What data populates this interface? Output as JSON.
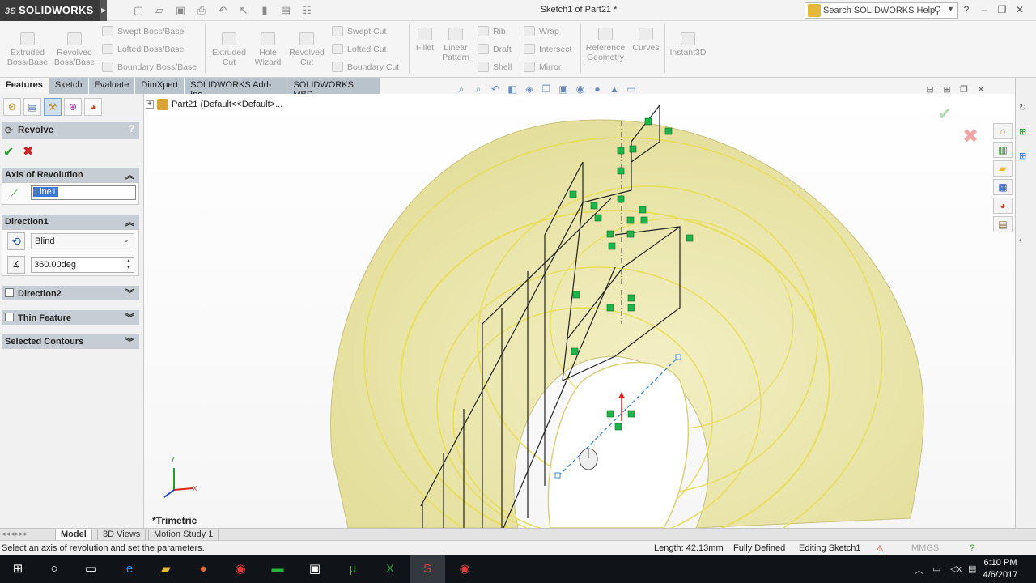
{
  "app": {
    "logo_text": "SOLIDWORKS",
    "logo_ds": "3S",
    "document_title": "Sketch1 of Part21 *",
    "search_placeholder": "Search SOLIDWORKS Help"
  },
  "commands": {
    "extruded_boss": "Extruded\nBoss/Base",
    "revolved_boss": "Revolved\nBoss/Base",
    "swept_boss": "Swept Boss/Base",
    "lofted_boss": "Lofted Boss/Base",
    "boundary_boss": "Boundary Boss/Base",
    "extruded_cut": "Extruded\nCut",
    "hole_wizard": "Hole\nWizard",
    "revolved_cut": "Revolved\nCut",
    "swept_cut": "Swept Cut",
    "lofted_cut": "Lofted Cut",
    "boundary_cut": "Boundary Cut",
    "fillet": "Fillet",
    "linear_pattern": "Linear\nPattern",
    "rib": "Rib",
    "draft": "Draft",
    "shell": "Shell",
    "wrap": "Wrap",
    "intersect": "Intersect",
    "mirror": "Mirror",
    "reference_geometry": "Reference\nGeometry",
    "curves": "Curves",
    "instant3d": "Instant3D"
  },
  "tabs": [
    "Features",
    "Sketch",
    "Evaluate",
    "DimXpert",
    "SOLIDWORKS Add-Ins",
    "SOLIDWORKS MBD"
  ],
  "property_manager": {
    "title": "Revolve",
    "axis_group": "Axis of Revolution",
    "axis_value": "Line1",
    "direction1_group": "Direction1",
    "end_condition": "Blind",
    "angle": "360.00deg",
    "direction2_group": "Direction2",
    "thin_feature_group": "Thin Feature",
    "selected_contours_group": "Selected Contours"
  },
  "viewport": {
    "tree_root": "Part21  (Default<<Default>...",
    "view_name": "*Trimetric",
    "triad": {
      "y": "Y",
      "x": "X"
    }
  },
  "bottom_tabs": [
    "Model",
    "3D Views",
    "Motion Study 1"
  ],
  "status": {
    "message": "Select an axis of revolution and set the parameters.",
    "length": "Length: 42.13mm",
    "defined": "Fully Defined",
    "editing": "Editing Sketch1",
    "units": "MMGS"
  },
  "clock": {
    "time": "6:10 PM",
    "date": "4/6/2017"
  }
}
